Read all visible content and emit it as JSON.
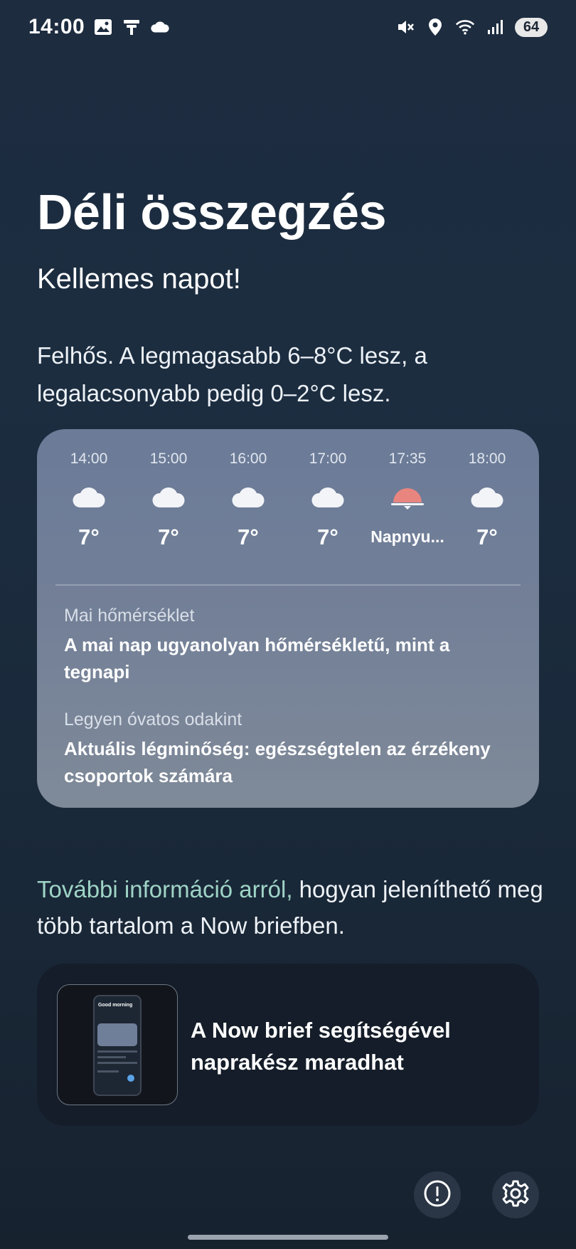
{
  "status_bar": {
    "time": "14:00",
    "left_icons": [
      "image-icon",
      "vpn-icon",
      "cloud-icon"
    ],
    "right_icons": [
      "mute-icon",
      "location-icon",
      "wifi-icon",
      "signal-icon"
    ],
    "battery": "64"
  },
  "header": {
    "title": "Déli összegzés",
    "subtitle": "Kellemes napot!"
  },
  "summary": "Felhős. A legmagasabb 6–8°C lesz, a legalacsonyabb pedig 0–2°C lesz.",
  "weather_card": {
    "hours": [
      {
        "time": "14:00",
        "icon": "cloud-icon",
        "temp": "7°"
      },
      {
        "time": "15:00",
        "icon": "cloud-icon",
        "temp": "7°"
      },
      {
        "time": "16:00",
        "icon": "cloud-icon",
        "temp": "7°"
      },
      {
        "time": "17:00",
        "icon": "cloud-icon",
        "temp": "7°"
      },
      {
        "time": "17:35",
        "icon": "sunset-icon",
        "temp": "Napnyu..."
      },
      {
        "time": "18:00",
        "icon": "cloud-icon",
        "temp": "7°"
      }
    ],
    "temperature": {
      "label": "Mai hőmérséklet",
      "text": "A mai nap ugyanolyan hőmérsékletű, mint a tegnapi"
    },
    "air_quality": {
      "label": "Legyen óvatos odakint",
      "text": "Aktuális légminőség: egészségtelen az érzékeny csoportok számára"
    }
  },
  "more_info": {
    "link": "További információ arról,",
    "rest": " hogyan jeleníthető meg több tartalom a Now briefben."
  },
  "brief_card": {
    "text": "A Now brief segítségével naprakész maradhat",
    "thumbnail_greeting": "Good morning"
  },
  "colors": {
    "background": "#1c2d40",
    "card": "#727f97",
    "link": "#9fd4c6",
    "sunset": "#e9857f"
  }
}
